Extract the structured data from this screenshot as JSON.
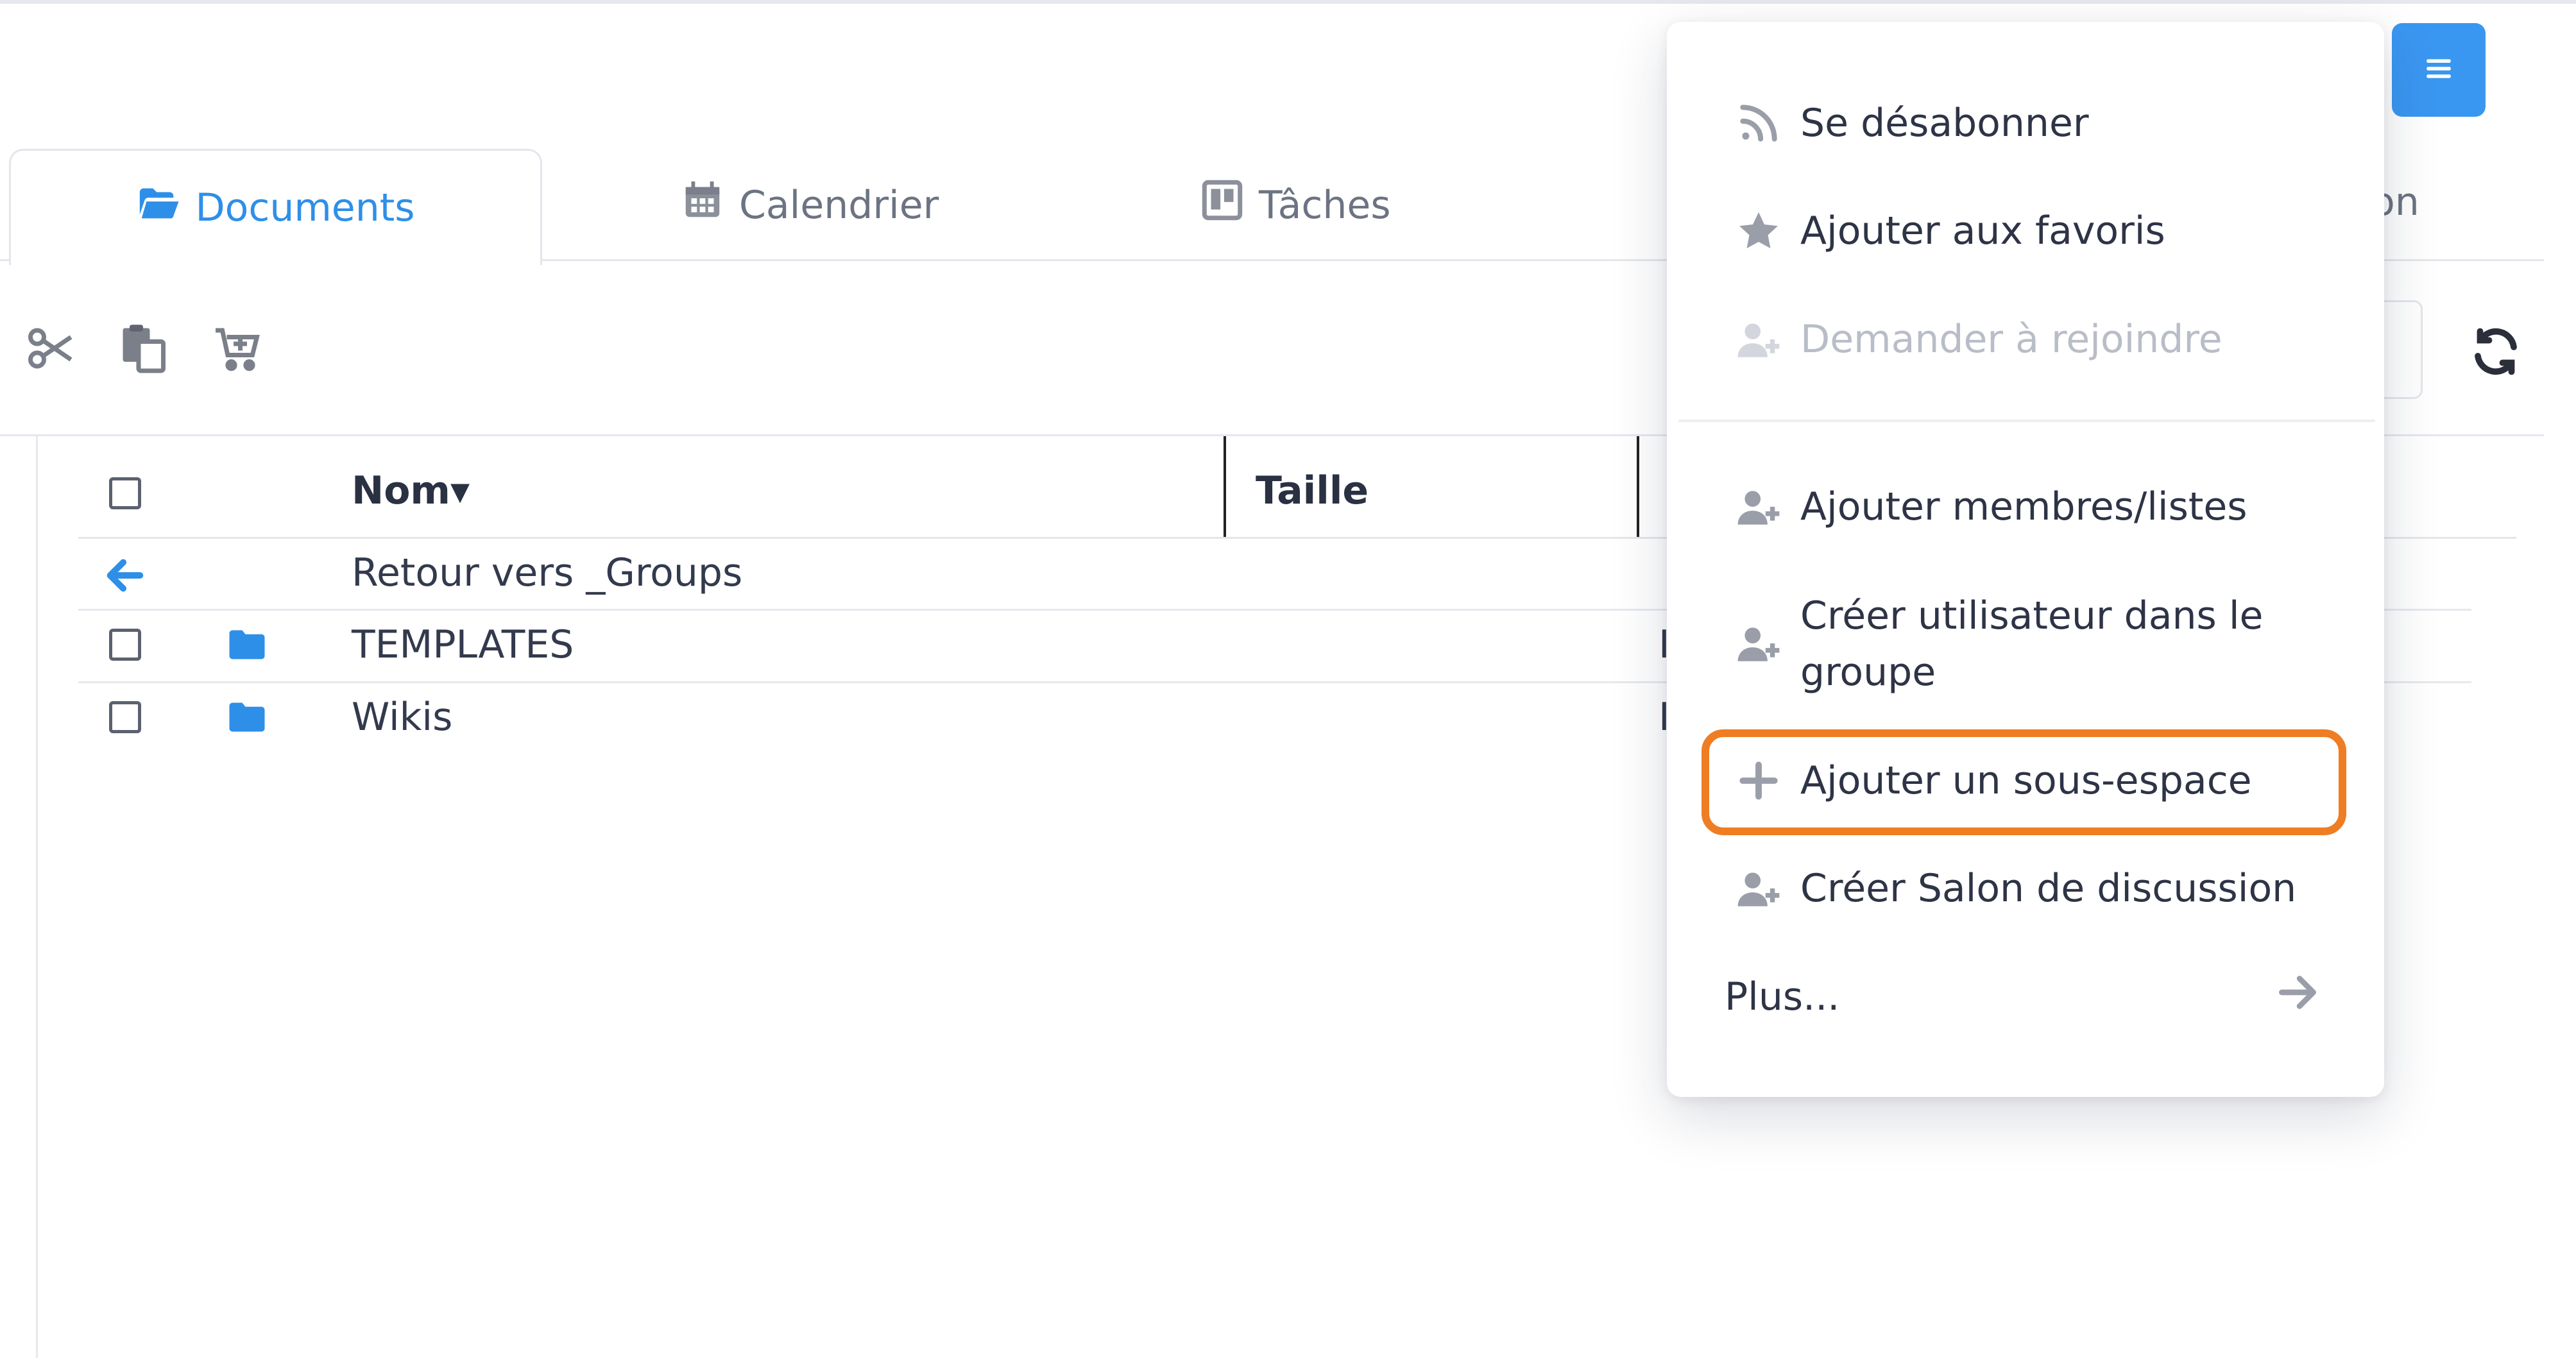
{
  "tabs": [
    {
      "label": "Documents",
      "icon": "folder-open-icon",
      "active": true
    },
    {
      "label": "Calendrier",
      "icon": "calendar-icon",
      "active": false
    },
    {
      "label": "Tâches",
      "icon": "kanban-board-icon",
      "active": false
    },
    {
      "label": "on",
      "icon": "",
      "active": false
    }
  ],
  "toolbar": {
    "tools": [
      "scissors-icon",
      "paste-icon",
      "cart-add-icon"
    ],
    "refresh_icon": "sync-icon"
  },
  "table": {
    "columns": [
      "Nom▾",
      "Taille"
    ],
    "back_row": {
      "label": "Retour vers _Groups",
      "icon": "arrow-left-icon"
    },
    "rows": [
      {
        "name": "TEMPLATES",
        "type": "folder",
        "extra": "I"
      },
      {
        "name": "Wikis",
        "type": "folder",
        "extra": "I"
      }
    ]
  },
  "menu_button": {
    "icon": "hamburger-menu-icon",
    "color": "#3a97f1"
  },
  "dropdown": {
    "items": [
      {
        "label": "Se désabonner",
        "icon": "rss-icon",
        "disabled": false
      },
      {
        "label": "Ajouter aux favoris",
        "icon": "star-icon",
        "disabled": false
      },
      {
        "label": "Demander à rejoindre",
        "icon": "user-plus-icon",
        "disabled": true
      },
      {
        "label": "Ajouter membres/listes",
        "icon": "user-plus-icon",
        "disabled": false
      },
      {
        "label": "Créer utilisateur dans le groupe",
        "label_line1": "Créer utilisateur dans le",
        "label_line2": "groupe",
        "icon": "user-plus-icon",
        "disabled": false
      },
      {
        "label": "Ajouter un sous-espace",
        "icon": "plus-icon",
        "disabled": false,
        "highlighted": true
      },
      {
        "label": "Créer Salon de discussion",
        "icon": "user-plus-icon",
        "disabled": false
      }
    ],
    "more_label": "Plus...",
    "more_icon": "arrow-right-icon",
    "highlight_color": "#ef7d23"
  },
  "colors": {
    "accent": "#2e8fe8",
    "text": "#333a4d",
    "muted": "#6c7382"
  }
}
